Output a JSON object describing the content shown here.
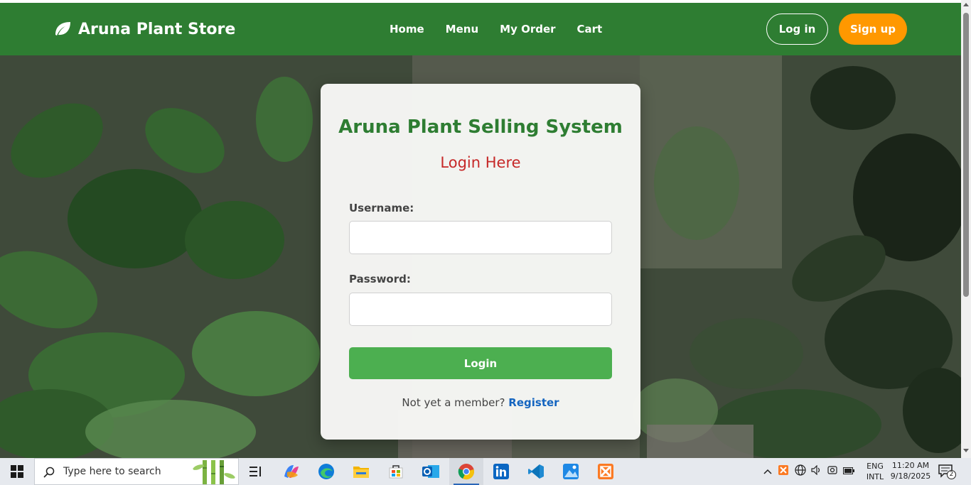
{
  "navbar": {
    "brand": "Aruna Plant Store",
    "links": [
      "Home",
      "Menu",
      "My Order",
      "Cart"
    ],
    "login_label": "Log in",
    "signup_label": "Sign up"
  },
  "card": {
    "title": "Aruna Plant Selling System",
    "subtitle": "Login Here",
    "username_label": "Username:",
    "username_value": "",
    "password_label": "Password:",
    "password_value": "",
    "login_button": "Login",
    "register_prompt": "Not yet a member?",
    "register_link": "Register"
  },
  "taskbar": {
    "search_placeholder": "Type here to search",
    "apps": [
      "task-view",
      "copilot",
      "edge",
      "file-explorer",
      "microsoft-store",
      "outlook",
      "chrome",
      "linkedin",
      "vscode",
      "photos",
      "xampp"
    ],
    "tray": {
      "language_top": "ENG",
      "language_bottom": "INTL",
      "time": "11:20 AM",
      "date": "9/18/2025",
      "notification_count": "2"
    }
  },
  "colors": {
    "navbar": "#2e7d32",
    "signup": "#ff9800",
    "title": "#2e7d32",
    "subtitle": "#c62828",
    "login_button": "#4caf50",
    "link": "#1565c0"
  }
}
